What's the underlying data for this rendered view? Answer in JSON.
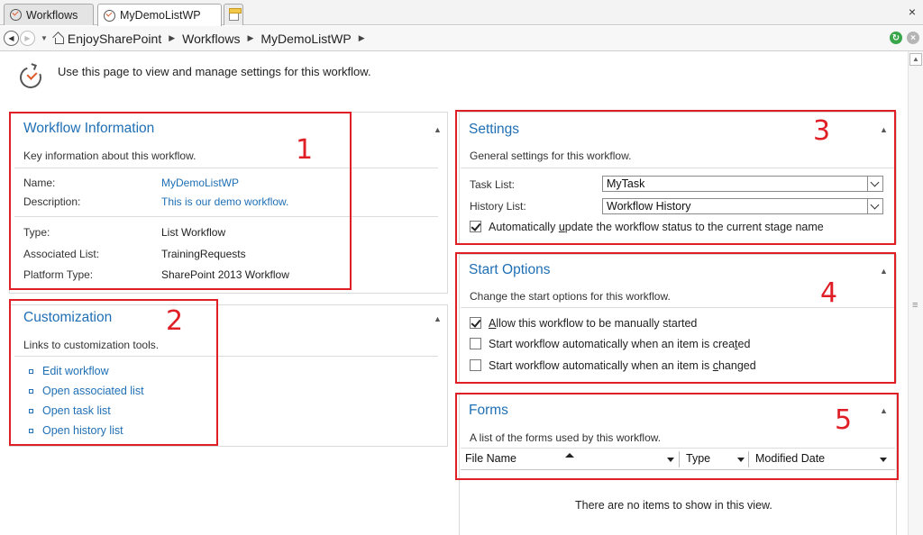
{
  "tabs": [
    {
      "label": "Workflows"
    },
    {
      "label": "MyDemoListWP"
    }
  ],
  "window": {
    "close_glyph": "×"
  },
  "breadcrumb": {
    "items": [
      "EnjoySharePoint",
      "Workflows",
      "MyDemoListWP"
    ],
    "separator": "▶"
  },
  "page": {
    "description": "Use this page to view and manage settings for this workflow."
  },
  "workflow_info": {
    "title": "Workflow Information",
    "subtitle": "Key information about this workflow.",
    "fields": [
      {
        "label": "Name:",
        "value": "MyDemoListWP",
        "link": true
      },
      {
        "label": "Description:",
        "value": "This is our demo workflow.",
        "link": true
      },
      {
        "label": "Type:",
        "value": "List Workflow",
        "link": false
      },
      {
        "label": "Associated List:",
        "value": "TrainingRequests",
        "link": false
      },
      {
        "label": "Platform Type:",
        "value": "SharePoint 2013 Workflow",
        "link": false
      }
    ]
  },
  "customization": {
    "title": "Customization",
    "subtitle": "Links to customization tools.",
    "links": [
      "Edit workflow",
      "Open associated list",
      "Open task list",
      "Open history list"
    ]
  },
  "settings": {
    "title": "Settings",
    "subtitle": "General settings for this workflow.",
    "task_list": {
      "label": "Task List:",
      "value": "MyTask"
    },
    "history_list": {
      "label": "History List:",
      "value": "Workflow History"
    },
    "auto_update": {
      "label_pre": "Automatically ",
      "label_u": "u",
      "label_post": "pdate the workflow status to the current stage name",
      "checked": true
    }
  },
  "start_options": {
    "title": "Start Options",
    "subtitle": "Change the start options for this workflow.",
    "options": [
      {
        "pre": "",
        "u": "A",
        "post": "llow this workflow to be manually started",
        "checked": true
      },
      {
        "pre": "Start workflow automatically when an item is crea",
        "u": "t",
        "post": "ed",
        "checked": false
      },
      {
        "pre": "Start workflow automatically when an item is ",
        "u": "c",
        "post": "hanged",
        "checked": false
      }
    ]
  },
  "forms": {
    "title": "Forms",
    "subtitle": "A list of the forms used by this workflow.",
    "columns": [
      "File Name",
      "Type",
      "Modified Date"
    ],
    "empty_message": "There are no items to show in this view."
  },
  "annotations": [
    "1",
    "2",
    "3",
    "4",
    "5"
  ],
  "colors": {
    "accent": "#1f6fb5",
    "annotation": "#e01e26"
  }
}
